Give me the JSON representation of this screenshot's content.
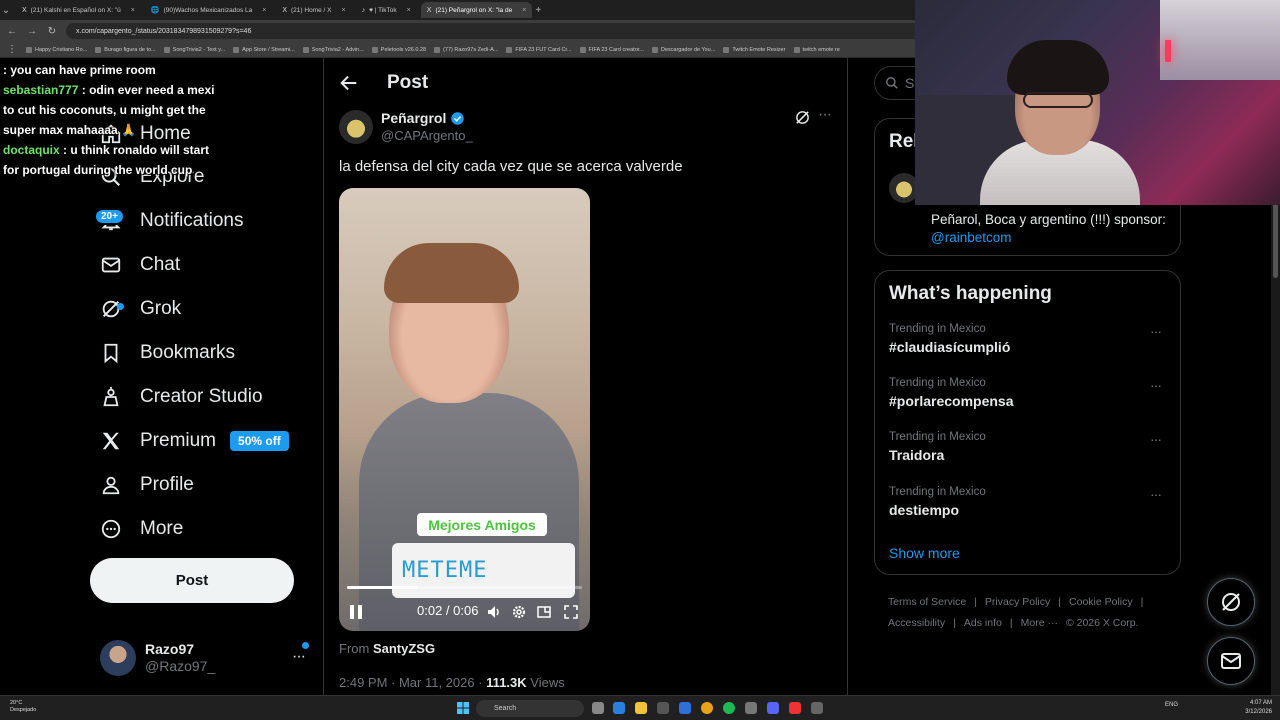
{
  "browser": {
    "tabs": [
      {
        "icon": "X",
        "label": "(21) Kalshi en Español on X: \"ü"
      },
      {
        "icon": "🌐",
        "label": "(90)Wachos Mexicanizados La"
      },
      {
        "icon": "X",
        "label": "(21) Home / X"
      },
      {
        "icon": "♪",
        "label": "♥ | TikTok"
      },
      {
        "icon": "X",
        "label": "(21) Peñargrol on X: \"la de"
      }
    ],
    "url": "x.com/capargento_/status/2031834798931509279?s=46",
    "bookmarks": [
      "Happy Cristiano Ro...",
      "Burago figura de to...",
      "SongTrivia2 - Text y...",
      "App Store / Streami...",
      "SongTrivia2 - Advin...",
      "Peletools v26.0.28",
      "(77) Razo97s Zedi-A...",
      "FIFA 23 FUT Card Cr...",
      "FIFA 23 Card creator...",
      "Descargador de You...",
      "Twitch Emote Resizer",
      "twitch emote re"
    ]
  },
  "chat": [
    {
      "user": "",
      "text": "you can have prime room"
    },
    {
      "user": "sebastian777",
      "text": ": odin ever need a mexi to cut his coconuts, u might get the super max mahaaaa 🙏"
    },
    {
      "user": "doctaquix",
      "text": ": u think ronaldo will start for portugal during the world cup"
    }
  ],
  "nav": {
    "home": "Home",
    "explore": "Explore",
    "notifications": "Notifications",
    "notifications_badge": "20+",
    "chat": "Chat",
    "grok": "Grok",
    "bookmarks": "Bookmarks",
    "creator_studio": "Creator Studio",
    "premium": "Premium",
    "premium_badge": "50% off",
    "profile": "Profile",
    "more": "More",
    "post_button": "Post"
  },
  "account": {
    "name": "Razo97",
    "handle": "@Razo97_",
    "more": "···"
  },
  "post": {
    "header_title": "Post",
    "author_name": "Peñargrol",
    "author_handle": "@CAPArgento_",
    "text": "la defensa del city cada vez que se acerca valverde",
    "video": {
      "sticker_top": "Mejores Amigos",
      "sticker_bottom": "METEME",
      "time": "0:02 / 0:06",
      "progress": 0.3
    },
    "from_label": "From",
    "from_user": "SantyZSG",
    "timestamp": "2:49 PM · Mar 11, 2026 · ",
    "views_count": "111.3K",
    "views_label": " Views"
  },
  "right": {
    "search_placeholder": "Se",
    "relevant_title": "Rel",
    "relevant_bio": "Peñarol, Boca y argentino (!!!) sponsor:",
    "relevant_link": "@rainbetcom",
    "happening_title": "What’s happening",
    "trends": [
      {
        "context": "Trending in Mexico",
        "title": "#claudiasícumplió"
      },
      {
        "context": "Trending in Mexico",
        "title": "#porlarecompensa"
      },
      {
        "context": "Trending in Mexico",
        "title": "Traidora"
      },
      {
        "context": "Trending in Mexico",
        "title": "destiempo"
      }
    ],
    "show_more": "Show more",
    "footer": [
      "Terms of Service",
      "|",
      "Privacy Policy",
      "|",
      "Cookie Policy",
      "|",
      "Accessibility",
      "|",
      "Ads info",
      "|",
      "More ···",
      "© 2026 X Corp."
    ]
  },
  "taskbar": {
    "weather_temp": "20°C",
    "weather_desc": "Despejado",
    "search": "Search",
    "tray": "ENG",
    "time": "4:07 AM",
    "date": "3/12/2026"
  },
  "colors": {
    "accent": "#1d9bf0",
    "background": "#000000",
    "text": "#e7e9ea",
    "muted": "#71767b"
  }
}
